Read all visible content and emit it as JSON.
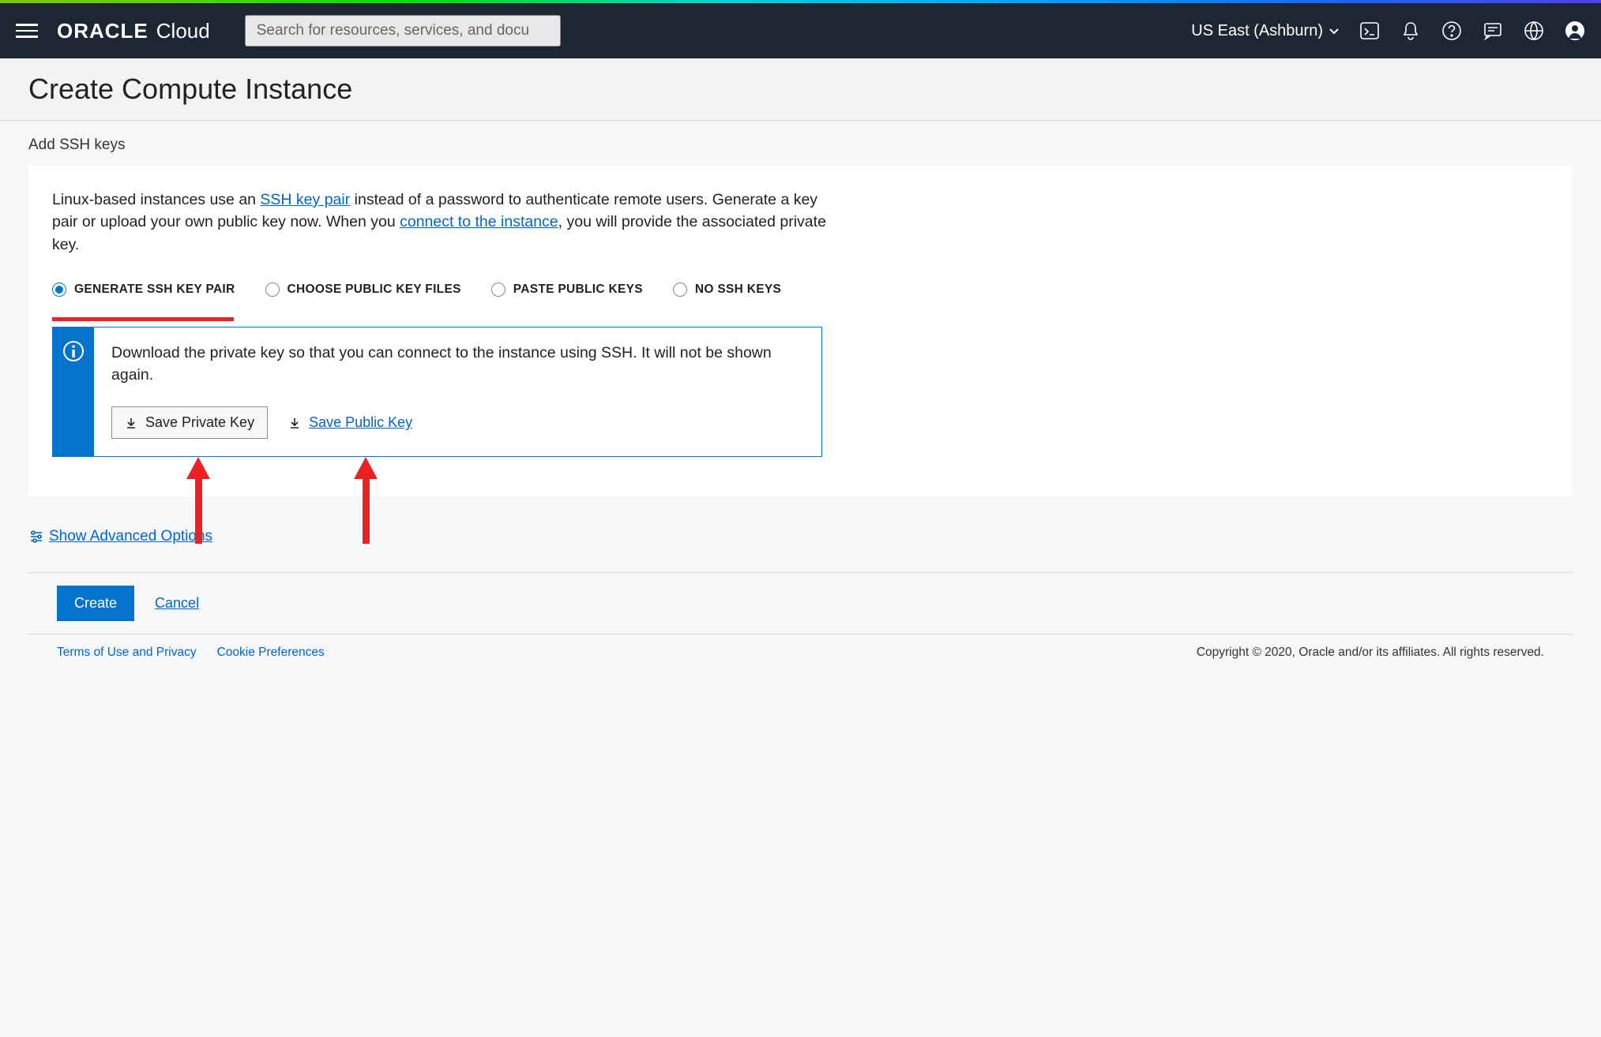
{
  "header": {
    "brand_main": "ORACLE",
    "brand_sub": "Cloud",
    "search_placeholder": "Search for resources, services, and docu",
    "region": "US East (Ashburn)"
  },
  "page": {
    "title": "Create Compute Instance",
    "section_label": "Add SSH keys"
  },
  "ssh": {
    "desc_prefix": "Linux-based instances use an ",
    "desc_link1": "SSH key pair",
    "desc_mid1": " instead of a password to authenticate remote users. Generate a key pair or upload your own public key now. When you ",
    "desc_link2": "connect to the instance",
    "desc_suffix": ", you will provide the associated private key.",
    "options": {
      "generate": "GENERATE SSH KEY PAIR",
      "choose": "CHOOSE PUBLIC KEY FILES",
      "paste": "PASTE PUBLIC KEYS",
      "none": "NO SSH KEYS"
    },
    "info_message": "Download the private key so that you can connect to the instance using SSH. It will not be shown again.",
    "save_private": "Save Private Key",
    "save_public": "Save Public Key"
  },
  "advanced": "Show Advanced Options",
  "actions": {
    "create": "Create",
    "cancel": "Cancel"
  },
  "footer": {
    "terms": "Terms of Use and Privacy",
    "cookies": "Cookie Preferences",
    "copyright": "Copyright © 2020, Oracle and/or its affiliates. All rights reserved."
  }
}
